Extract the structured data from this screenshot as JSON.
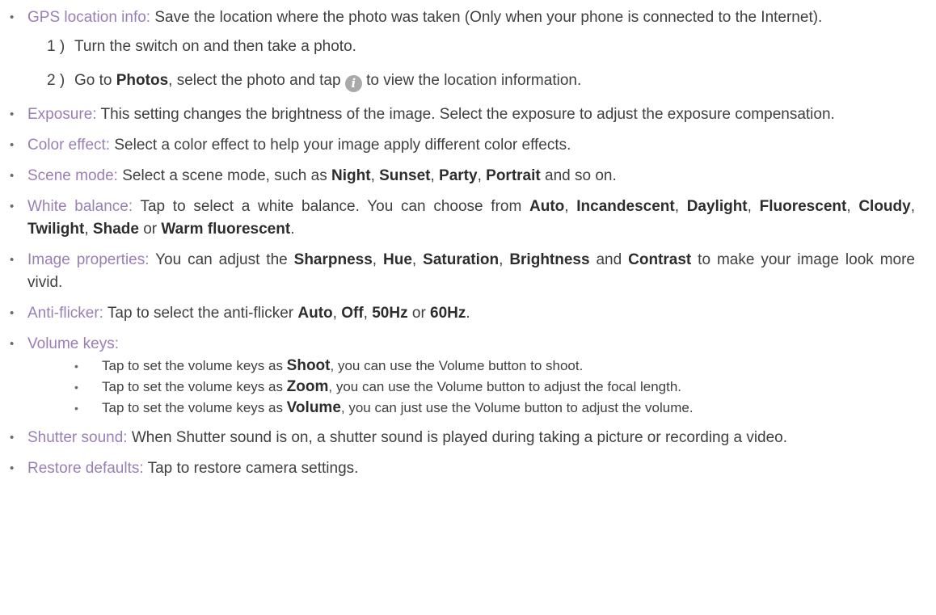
{
  "bullet": "•",
  "gps": {
    "term": "GPS location info:",
    "text": " Save the location where the photo was taken (Only when your phone is connected to the Internet).",
    "step1": {
      "num": "1 )",
      "text": "Turn the switch on and then take a photo."
    },
    "step2": {
      "num": "2 )",
      "pre": "Go to ",
      "bold": "Photos",
      "mid": ", select the photo and tap ",
      "icon": "i",
      "post": " to view the location information."
    }
  },
  "exposure": {
    "term": "Exposure:",
    "text": " This setting changes the brightness of the image. Select the exposure to adjust the exposure compensation."
  },
  "color_effect": {
    "term": "Color effect:",
    "text": " Select a color effect to help your image apply different color effects."
  },
  "scene_mode": {
    "term": "Scene mode:",
    "pre": "  Select a scene mode, such as ",
    "o1": "Night",
    "o2": "Sunset",
    "o3": "Party",
    "o4": "Portrait",
    "post": " and so on.",
    "comma": ", "
  },
  "white_balance": {
    "term": "White balance:",
    "pre": " Tap to select a white balance. You can choose from ",
    "o1": "Auto",
    "o2": "Incandescent",
    "o3": "Daylight",
    "o4": "Fluorescent",
    "o5": "Cloudy",
    "o6": "Twilight",
    "o7": "Shade",
    "or": " or ",
    "o8": "Warm fluorescent",
    "end": ".",
    "comma": ", "
  },
  "image_properties": {
    "term": "Image properties:",
    "pre": " You can adjust the ",
    "o1": "Sharpness",
    "o2": "Hue",
    "o3": "Saturation",
    "o4": "Brightness",
    "and": " and ",
    "o5": "Contrast",
    "post": " to make your image look more vivid.",
    "comma": ", "
  },
  "anti_flicker": {
    "term": "Anti-flicker:",
    "pre": " Tap to select the anti-flicker ",
    "o1": "Auto",
    "o2": "Off",
    "o3": "50Hz",
    "or": " or ",
    "o4": "60Hz",
    "end": ".",
    "comma": ", "
  },
  "volume_keys": {
    "term": "Volume keys:",
    "sub_bullet": "•",
    "items": [
      {
        "pre": "Tap to set the volume keys as ",
        "bold": "Shoot",
        "post": ", you can use the Volume button to shoot."
      },
      {
        "pre": "Tap to set the volume keys as ",
        "bold": "Zoom",
        "post": ", you can use the Volume button to adjust the focal length."
      },
      {
        "pre": "Tap to set the volume keys as ",
        "bold": "Volume",
        "post": ", you can just use the Volume button to adjust the volume."
      }
    ]
  },
  "shutter_sound": {
    "term": "Shutter sound:",
    "text": " When Shutter sound is on, a shutter sound is played during taking a picture or recording a video."
  },
  "restore_defaults": {
    "term": "Restore defaults:",
    "text": " Tap to restore camera settings."
  }
}
